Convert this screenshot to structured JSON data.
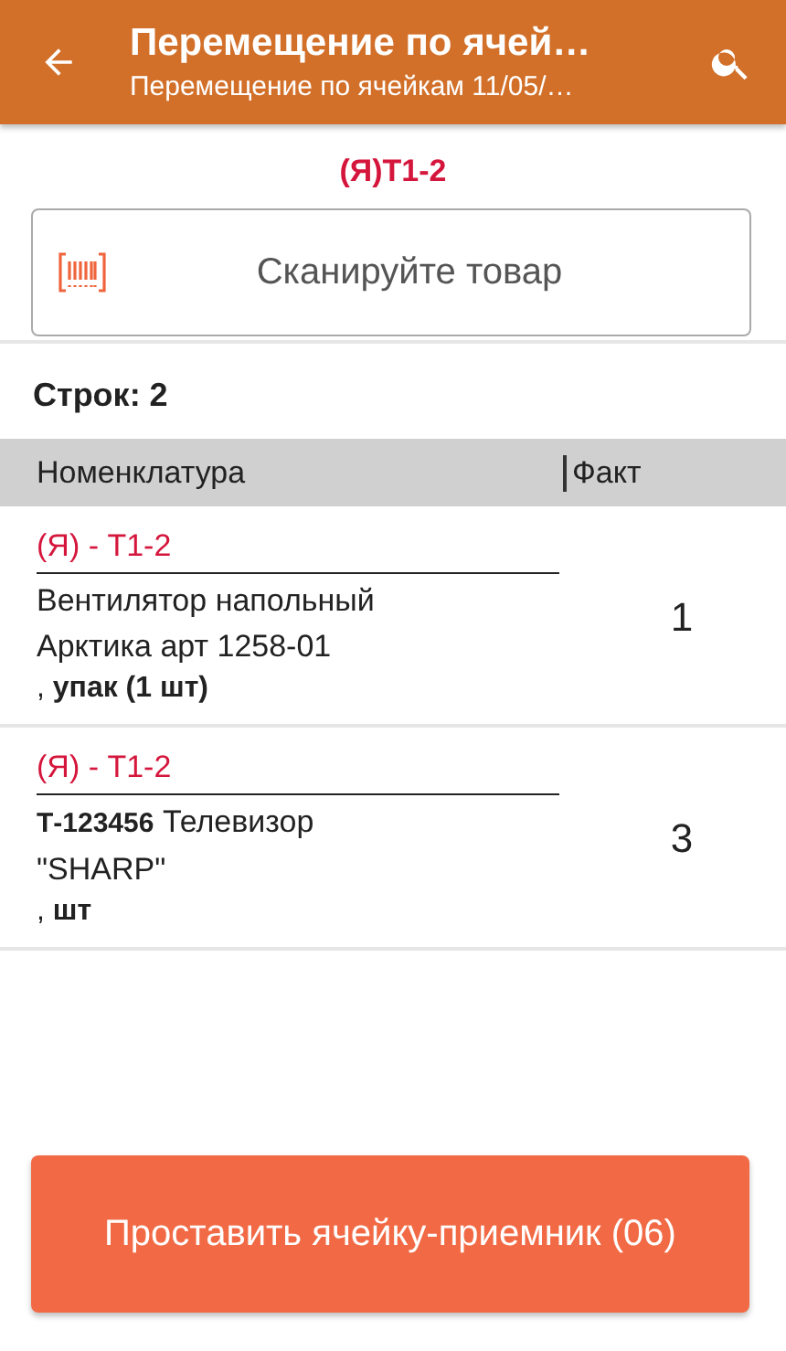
{
  "header": {
    "title": "Перемещение по ячей…",
    "subtitle": "Перемещение по ячейкам 11/05/…"
  },
  "cell": "(Я)Т1-2",
  "scan_field": {
    "placeholder": "Сканируйте товар"
  },
  "rows_count": "Строк: 2",
  "table": {
    "columns": [
      "Номенклатура",
      "Факт"
    ],
    "rows": [
      {
        "cell": "(Я) - Т1-2",
        "name": "Вентилятор напольный Арктика арт 1258-01",
        "unit": ", **упак (1 шт)**",
        "fact": "1"
      },
      {
        "cell": "(Я) - Т1-2",
        "name": "**Т-123456** Телевизор \"SHARP\"",
        "unit": ", **шт**",
        "fact": "3"
      }
    ]
  },
  "action_button": "Проставить ячейку-приемник (06)"
}
